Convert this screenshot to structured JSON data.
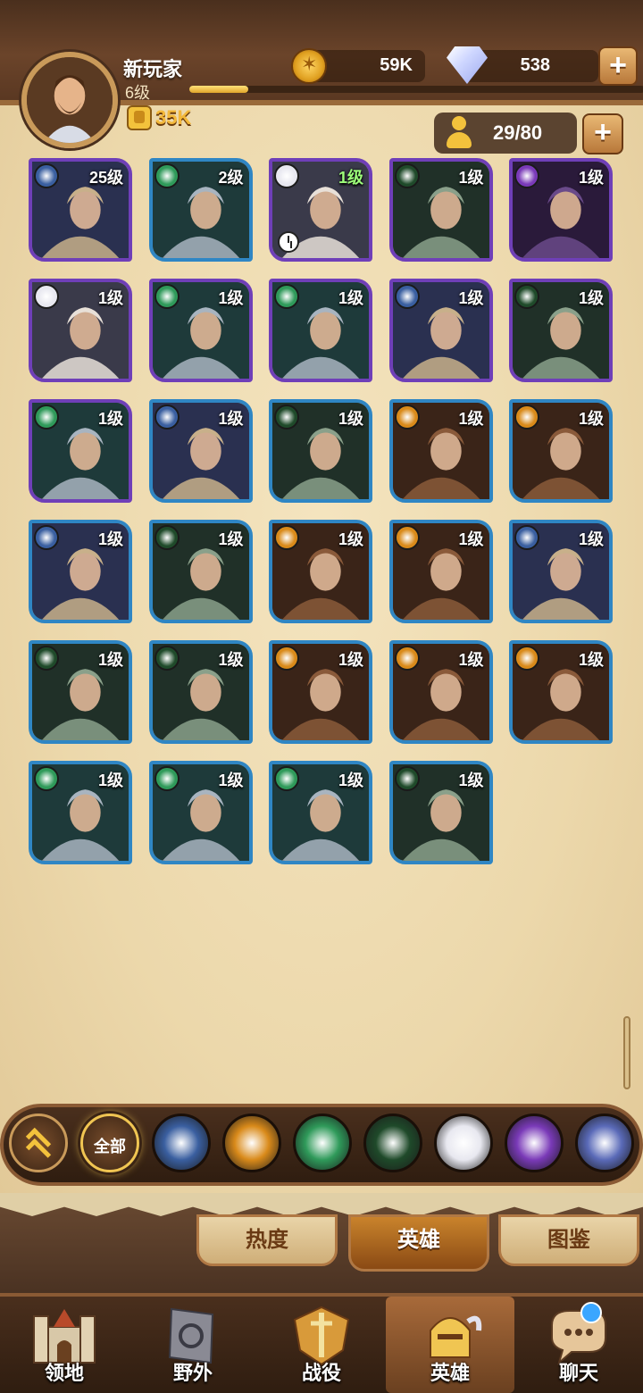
{
  "player": {
    "name": "新玩家",
    "level": "6级",
    "exp_progress": 0.13,
    "power": "35K"
  },
  "currency": {
    "gold": "59K",
    "gems": "538"
  },
  "roster": {
    "count": "29/80"
  },
  "heroes": [
    {
      "level": "25级",
      "frame": "purple",
      "faction": "light",
      "icon": "star-faction-icon"
    },
    {
      "level": "2级",
      "frame": "blue",
      "faction": "nature",
      "icon": "leaf-faction-icon"
    },
    {
      "level": "1级",
      "frame": "purple",
      "faction": "celestial",
      "icon": "sun-faction-icon",
      "green": true,
      "clock": true
    },
    {
      "level": "1级",
      "frame": "purple",
      "faction": "dark",
      "icon": "eye-faction-icon"
    },
    {
      "level": "1级",
      "frame": "purple",
      "faction": "void",
      "icon": "void-faction-icon"
    },
    {
      "level": "1级",
      "frame": "purple",
      "faction": "celestial",
      "icon": "sun-faction-icon"
    },
    {
      "level": "1级",
      "frame": "purple",
      "faction": "nature",
      "icon": "leaf-faction-icon"
    },
    {
      "level": "1级",
      "frame": "purple",
      "faction": "nature",
      "icon": "leaf-faction-icon"
    },
    {
      "level": "1级",
      "frame": "purple",
      "faction": "light",
      "icon": "star-faction-icon"
    },
    {
      "level": "1级",
      "frame": "purple",
      "faction": "dark",
      "icon": "eye-faction-icon"
    },
    {
      "level": "1级",
      "frame": "purple",
      "faction": "nature",
      "icon": "leaf-faction-icon"
    },
    {
      "level": "1级",
      "frame": "blue",
      "faction": "light",
      "icon": "star-faction-icon"
    },
    {
      "level": "1级",
      "frame": "blue",
      "faction": "dark",
      "icon": "eye-faction-icon"
    },
    {
      "level": "1级",
      "frame": "blue",
      "faction": "fire",
      "icon": "flame-faction-icon"
    },
    {
      "level": "1级",
      "frame": "blue",
      "faction": "fire",
      "icon": "flame-faction-icon"
    },
    {
      "level": "1级",
      "frame": "blue",
      "faction": "light",
      "icon": "star-faction-icon"
    },
    {
      "level": "1级",
      "frame": "blue",
      "faction": "dark",
      "icon": "eye-faction-icon"
    },
    {
      "level": "1级",
      "frame": "blue",
      "faction": "fire",
      "icon": "flame-faction-icon"
    },
    {
      "level": "1级",
      "frame": "blue",
      "faction": "fire",
      "icon": "flame-faction-icon"
    },
    {
      "level": "1级",
      "frame": "blue",
      "faction": "light",
      "icon": "star-faction-icon"
    },
    {
      "level": "1级",
      "frame": "blue",
      "faction": "dark",
      "icon": "eye-faction-icon"
    },
    {
      "level": "1级",
      "frame": "blue",
      "faction": "dark",
      "icon": "eye-faction-icon"
    },
    {
      "level": "1级",
      "frame": "blue",
      "faction": "fire",
      "icon": "flame-faction-icon"
    },
    {
      "level": "1级",
      "frame": "blue",
      "faction": "fire",
      "icon": "flame-faction-icon"
    },
    {
      "level": "1级",
      "frame": "blue",
      "faction": "fire",
      "icon": "flame-faction-icon"
    },
    {
      "level": "1级",
      "frame": "blue",
      "faction": "nature",
      "icon": "leaf-faction-icon"
    },
    {
      "level": "1级",
      "frame": "blue",
      "faction": "nature",
      "icon": "leaf-faction-icon"
    },
    {
      "level": "1级",
      "frame": "blue",
      "faction": "nature",
      "icon": "leaf-faction-icon"
    },
    {
      "level": "1级",
      "frame": "blue",
      "faction": "dark",
      "icon": "eye-faction-icon"
    }
  ],
  "filters": {
    "all_label": "全部",
    "factions": [
      "star-faction-icon",
      "flame-faction-icon",
      "leaf-faction-icon",
      "eye-faction-icon",
      "sun-faction-icon",
      "void-faction-icon",
      "shield-faction-icon"
    ]
  },
  "sub_tabs": [
    "热度",
    "英雄",
    "图鉴"
  ],
  "nav": [
    "领地",
    "野外",
    "战役",
    "英雄",
    "聊天"
  ],
  "colors": {
    "light": "#3a5fa0",
    "nature": "#2f9a5a",
    "celestial": "#e8e8f0",
    "dark": "#1f4a2a",
    "void": "#7a3ab8",
    "fire": "#d98a1a",
    "shield": "#5a6ab8"
  }
}
